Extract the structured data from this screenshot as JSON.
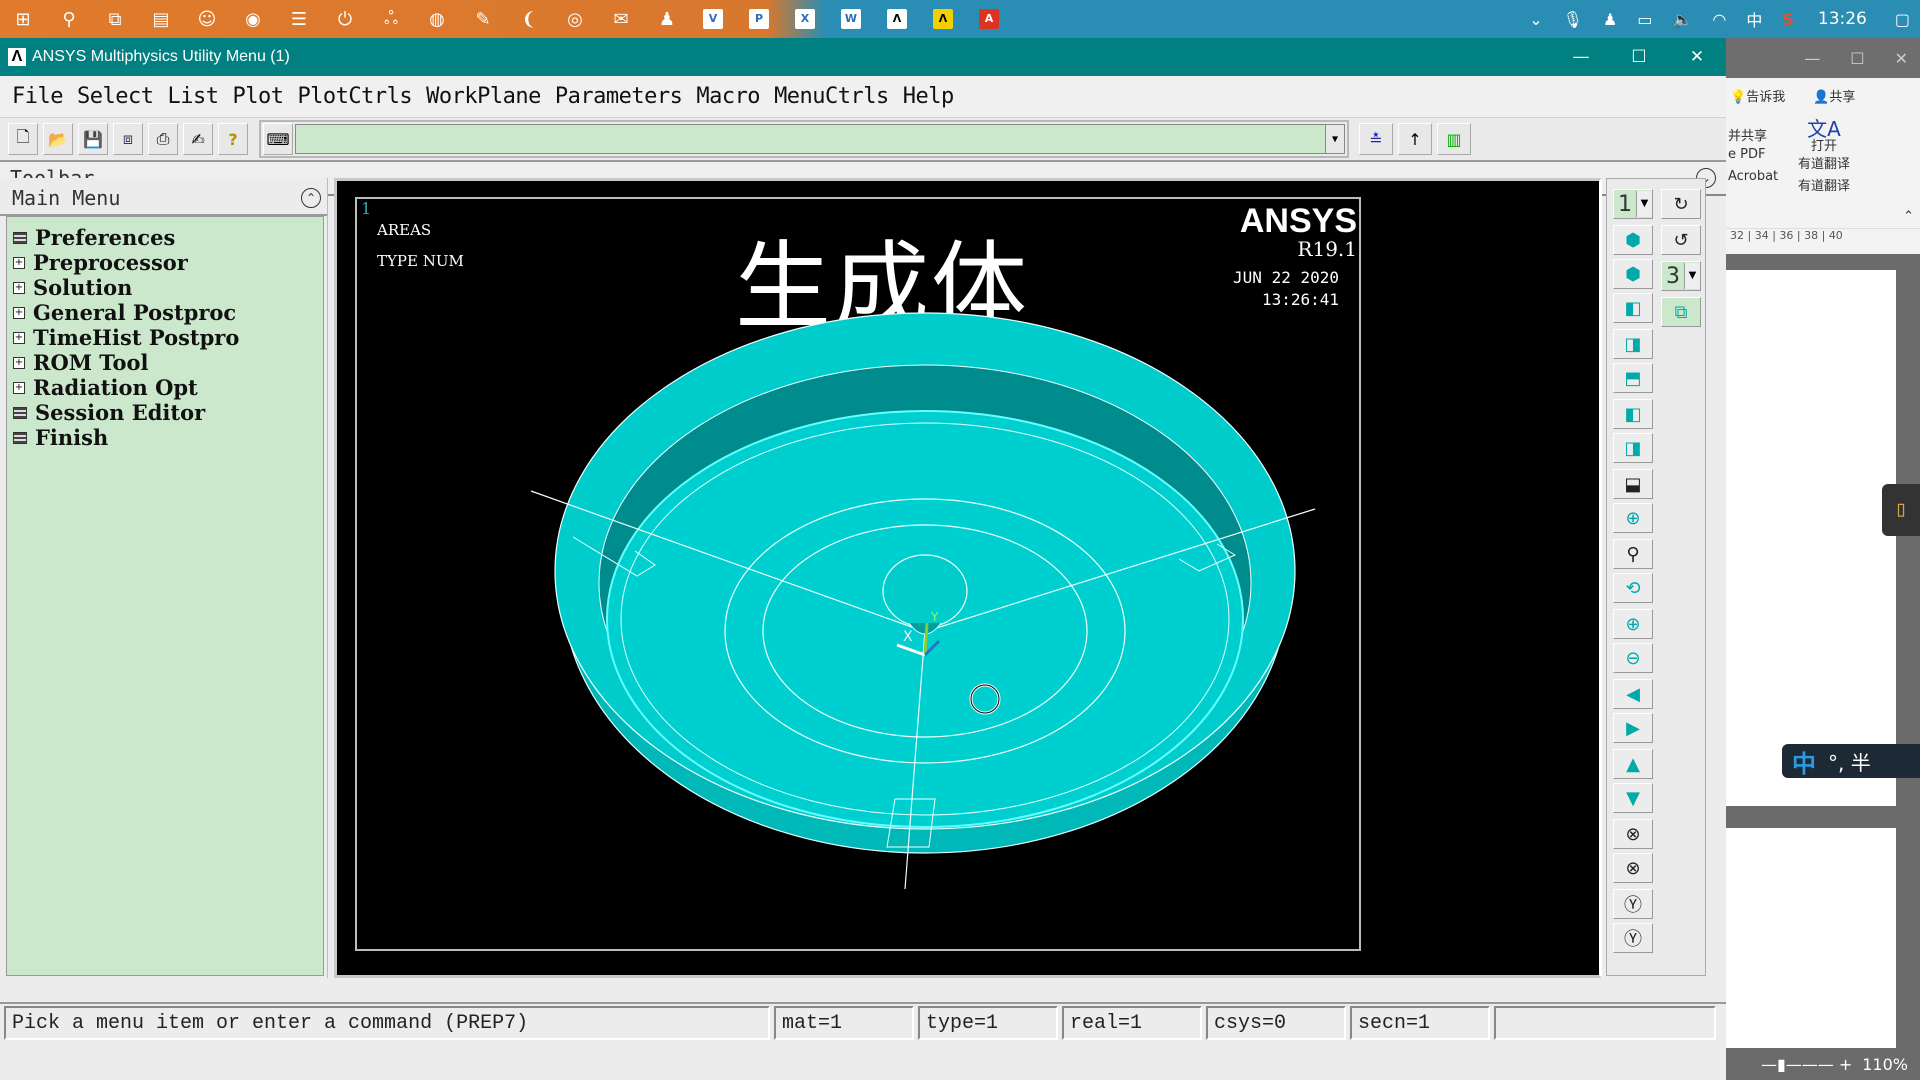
{
  "taskbar": {
    "start_icon": "windows-start-icon",
    "pinned_icons": [
      "search-icon",
      "task-view-icon",
      "file-manager-icon",
      "smiley-app-icon",
      "browser-icon",
      "news-icon",
      "power-icon",
      "baidu-icon",
      "book-icon",
      "notes-icon",
      "browser2-icon",
      "netease-music-icon",
      "wechat-icon",
      "qq-icon",
      "visio-icon",
      "powerpoint-icon",
      "excel-icon",
      "word-icon",
      "ansys-icon",
      "ansys-active-icon",
      "acrobat-icon"
    ],
    "tray": {
      "icons": [
        "chevron-up-icon",
        "microphone-icon",
        "qq-penguin-icon",
        "battery-icon",
        "volume-icon",
        "wifi-icon",
        "ime-zhong-icon",
        "sogou-icon",
        "notification-icon"
      ],
      "ime_label": "中",
      "clock": "13:26"
    }
  },
  "window": {
    "title": "ANSYS Multiphysics Utility Menu (1)",
    "controls": {
      "minimize": "—",
      "maximize": "☐",
      "close": "✕"
    }
  },
  "menubar": [
    "File",
    "Select",
    "List",
    "Plot",
    "PlotCtrls",
    "WorkPlane",
    "Parameters",
    "Macro",
    "MenuCtrls",
    "Help"
  ],
  "toolbar": {
    "buttons": [
      "new-file-icon",
      "open-file-icon",
      "save-icon",
      "save-db-icon",
      "print-icon",
      "report-icon",
      "help-icon"
    ],
    "command_input_value": "",
    "right_buttons": [
      "raise-hidden-icon",
      "reset-picking-icon",
      "contact-manager-icon"
    ],
    "label": "Toolbar"
  },
  "main_menu": {
    "title": "Main Menu",
    "items": [
      {
        "label": "Preferences",
        "type": "page"
      },
      {
        "label": "Preprocessor",
        "type": "expand"
      },
      {
        "label": "Solution",
        "type": "expand"
      },
      {
        "label": "General Postproc",
        "type": "expand"
      },
      {
        "label": "TimeHist Postpro",
        "type": "expand"
      },
      {
        "label": "ROM Tool",
        "type": "expand"
      },
      {
        "label": "Radiation Opt",
        "type": "expand"
      },
      {
        "label": "Session Editor",
        "type": "page"
      },
      {
        "label": "Finish",
        "type": "page"
      }
    ]
  },
  "graphics": {
    "window_number": "1",
    "plot_type": "AREAS",
    "numbering": "TYPE NUM",
    "title": "生成体",
    "brand": "ANSYS",
    "version": "R19.1",
    "date": "JUN 22 2020",
    "time": "13:26:41",
    "triad_label_x": "X",
    "triad_label_y": "Y",
    "model_color": "#00cccc"
  },
  "view_toolbar": {
    "window_select": "1",
    "window_select_2": "3",
    "buttons": [
      "iso-view-icon",
      "oblique-view-icon",
      "front-view-icon",
      "right-view-icon",
      "top-view-icon",
      "back-view-icon",
      "left-view-icon",
      "bottom-view-icon",
      "zoom-box-icon",
      "zoom-icon",
      "zoom-back-icon",
      "zoom-in-icon",
      "zoom-out-icon",
      "pan-left-icon",
      "pan-right-icon",
      "pan-up-icon",
      "pan-down-icon",
      "rotate-x-plus-icon",
      "rotate-x-minus-icon",
      "rotate-y-plus-icon",
      "rotate-y-minus-icon"
    ],
    "side_buttons": [
      "rotate-z-plus-icon",
      "rotate-z-minus-icon",
      "dynamic-mode-icon"
    ]
  },
  "statusbar": {
    "prompt": "Pick a menu item or enter a command (PREP7)",
    "mat": "mat=1",
    "type": "type=1",
    "real": "real=1",
    "csys": "csys=0",
    "secn": "secn=1"
  },
  "background_window": {
    "tell_me": "告诉我",
    "share": "共享",
    "share_pdf": "并共享",
    "pdf": "e PDF",
    "open": "打开",
    "youdao": "有道翻译",
    "acrobat": "Acrobat",
    "youdao_group": "有道翻译",
    "ruler": [
      "32",
      "34",
      "36",
      "38",
      "40"
    ],
    "zoom_level": "110%",
    "ime_text": "°, 半"
  }
}
